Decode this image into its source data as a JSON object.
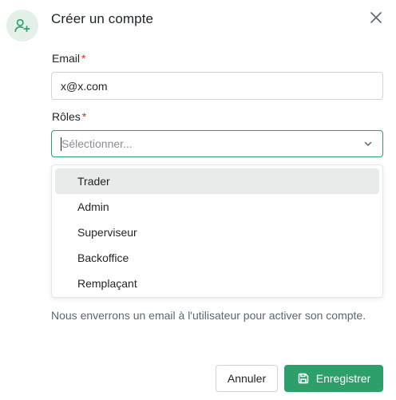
{
  "dialog": {
    "title": "Créer un compte"
  },
  "email": {
    "label": "Email",
    "required_mark": "*",
    "value": "x@x.com"
  },
  "roles": {
    "label": "Rôles",
    "required_mark": "*",
    "placeholder": "Sélectionner...",
    "options": [
      {
        "label": "Trader"
      },
      {
        "label": "Admin"
      },
      {
        "label": "Superviseur"
      },
      {
        "label": "Backoffice"
      },
      {
        "label": "Remplaçant"
      }
    ],
    "hovered_option": "Trader"
  },
  "help": {
    "text": "Nous enverrons un email à l'utilisateur pour activer son compte."
  },
  "actions": {
    "cancel_label": "Annuler",
    "save_label": "Enregistrer"
  },
  "colors": {
    "accent": "#2e9f6b",
    "accent_soft": "#e3f1e8",
    "required": "#d92d20",
    "hover": "#e9eaea"
  },
  "icons": {
    "header": "user-plus-icon",
    "close": "close-icon",
    "select": "chevron-down-icon",
    "save": "save-icon"
  }
}
